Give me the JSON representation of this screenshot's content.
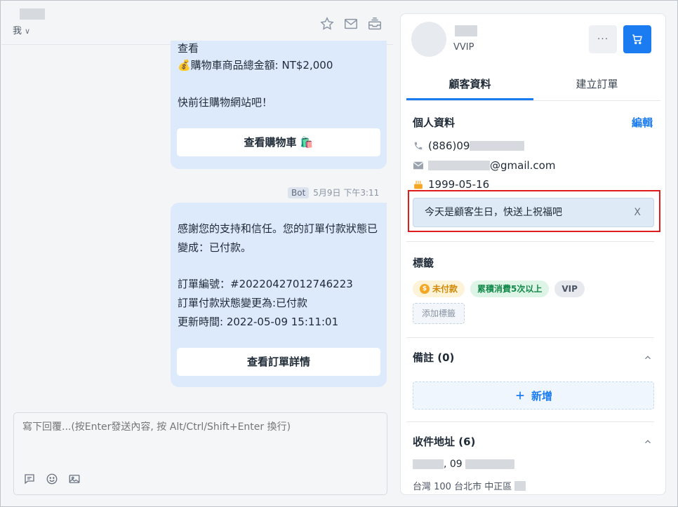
{
  "chat": {
    "header": {
      "me_label": "我",
      "icons": [
        "star-icon",
        "mail-icon",
        "inbox-icon"
      ]
    },
    "messages": [
      {
        "from": "bot",
        "lines": [
          "查看",
          "💰購物車商品總金額: NT$2,000",
          "快前往購物網站吧！"
        ],
        "button": "查看購物車 🛍️"
      },
      {
        "from": "bot",
        "tag": "Bot",
        "time": "5月9日 下午3:11",
        "lines": [
          "感謝您的支持和信任。您的訂單付款狀態已",
          "變成：已付款。",
          "訂單編號：#20220427012746223",
          "訂單付款狀態變更為:已付款",
          "更新時間: 2022-05-09 15:11:01"
        ],
        "button": "查看訂單詳情"
      }
    ],
    "composer": {
      "placeholder": "寫下回覆...(按Enter發送內容, 按 Alt/Ctrl/Shift+Enter 換行)",
      "tools": [
        "template-icon",
        "emoji-icon",
        "image-icon"
      ]
    }
  },
  "customer": {
    "level": "VVIP",
    "more_label": "···",
    "tabs": [
      {
        "label": "顧客資料",
        "active": true
      },
      {
        "label": "建立訂單",
        "active": false
      }
    ],
    "profile": {
      "title": "個人資料",
      "edit_label": "編輯",
      "phone_prefix": "(886)09",
      "email_suffix": "@gmail.com",
      "birthday": "1999-05-16",
      "birthday_alert": "今天是顧客生日，快送上祝福吧",
      "alert_close": "X"
    },
    "tags_section": {
      "title": "標籤",
      "tags": [
        {
          "label": "未付款",
          "style": "unpaid",
          "icon": "$"
        },
        {
          "label": "累積消費5次以上",
          "style": "spend"
        },
        {
          "label": "VIP",
          "style": "vip"
        }
      ],
      "add_label": "添加標籤"
    },
    "notes": {
      "title": "備註 (0)",
      "add_label": "新增"
    },
    "addresses": {
      "title": "收件地址 (6)",
      "phone_sep": ", 09",
      "line2": "台灣 100 台北市 中正區"
    }
  },
  "colors": {
    "accent": "#1a7cf0",
    "bubble": "#ddeafb",
    "highlight": "#e01b1b",
    "tag_unpaid": "#d08a06",
    "tag_spend": "#12894a"
  }
}
